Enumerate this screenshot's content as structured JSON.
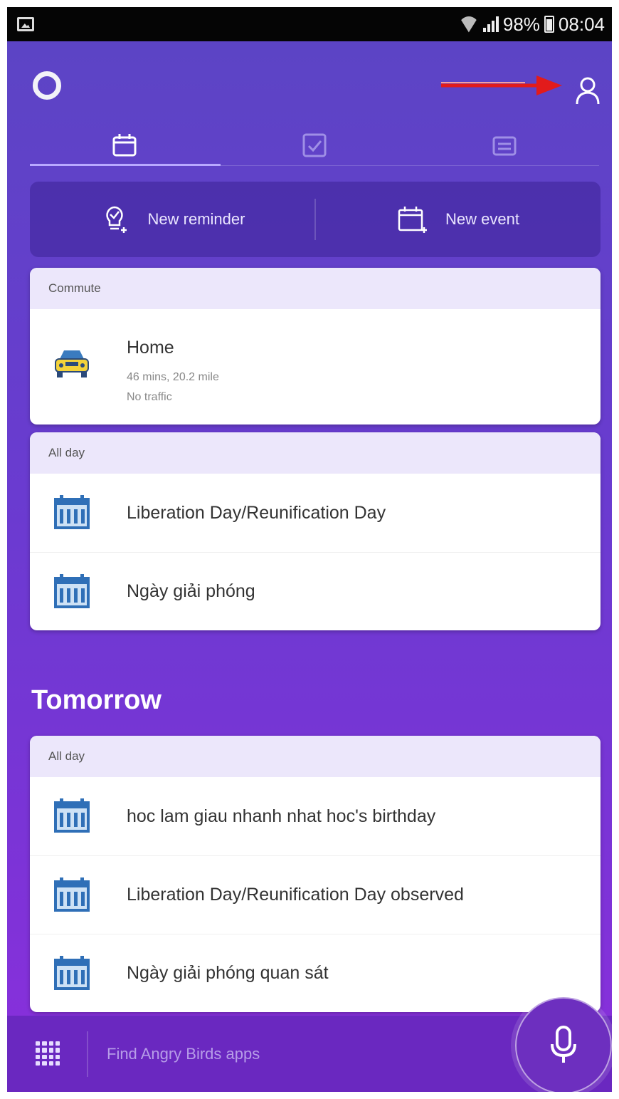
{
  "status_bar": {
    "battery": "98%",
    "time": "08:04"
  },
  "quick_actions": {
    "reminder_label": "New reminder",
    "event_label": "New event"
  },
  "commute_card": {
    "header": "Commute",
    "title": "Home",
    "detail": "46 mins, 20.2 mile",
    "traffic": "No traffic",
    "icon": "car-icon"
  },
  "today_card": {
    "header": "All day",
    "items": [
      {
        "label": "Liberation Day/Reunification Day",
        "icon": "calendar-icon"
      },
      {
        "label": "Ngày giải phóng",
        "icon": "calendar-icon"
      }
    ]
  },
  "tomorrow": {
    "title": "Tomorrow",
    "header": "All day",
    "items": [
      {
        "label": "hoc lam giau nhanh nhat hoc's birthday",
        "icon": "calendar-icon"
      },
      {
        "label": "Liberation Day/Reunification Day observed",
        "icon": "calendar-icon"
      },
      {
        "label": "Ngày giải phóng quan sát",
        "icon": "calendar-icon"
      }
    ]
  },
  "bottom_bar": {
    "search_placeholder": "Find Angry Birds apps"
  },
  "colors": {
    "accent": "#6a3bd0",
    "arrow": "#e21b1b"
  }
}
